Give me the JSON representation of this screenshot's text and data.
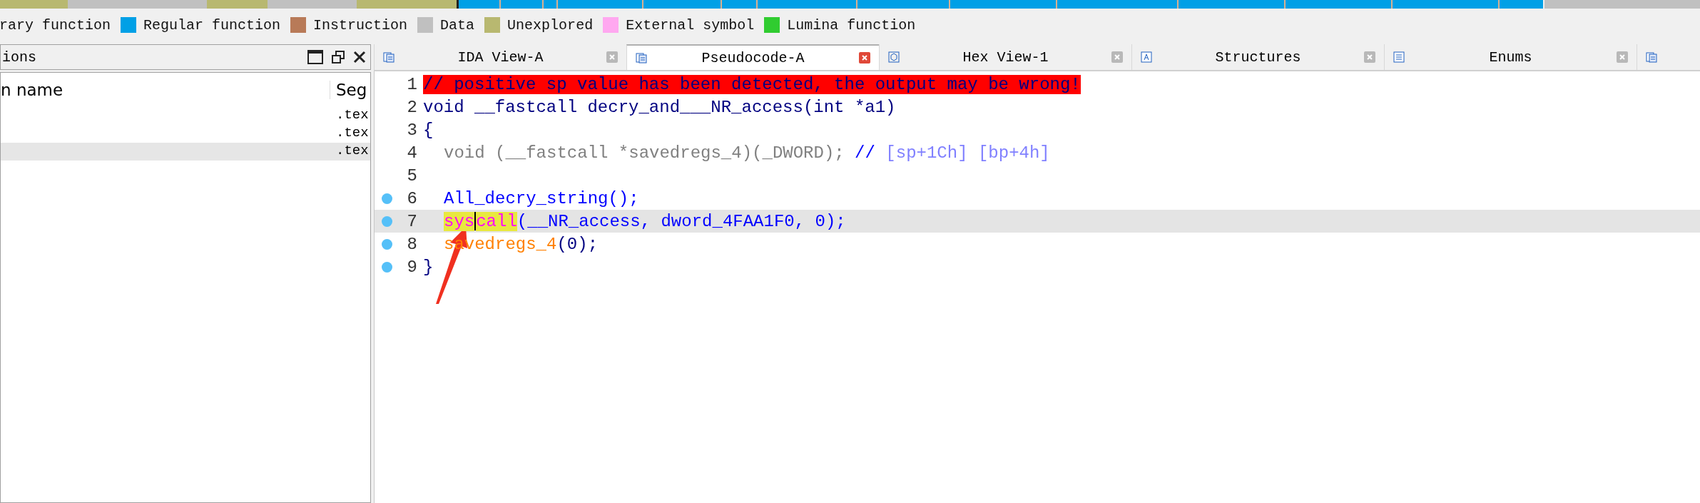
{
  "legend": [
    {
      "label": "rary function"
    },
    {
      "label": "Regular function",
      "color": "#00a0e6"
    },
    {
      "label": "Instruction",
      "color": "#b87a58"
    },
    {
      "label": "Data",
      "color": "#c0c0c0"
    },
    {
      "label": "Unexplored",
      "color": "#b8b870"
    },
    {
      "label": "External symbol",
      "color": "#ffa8f0"
    },
    {
      "label": "Lumina function",
      "color": "#30cc30"
    }
  ],
  "functions_panel": {
    "title": "ions",
    "columns": [
      "n name",
      "Seg"
    ],
    "rows": [
      {
        "segment": ".tex",
        "selected": false
      },
      {
        "segment": ".tex",
        "selected": false
      },
      {
        "segment": ".tex",
        "selected": true
      }
    ]
  },
  "tabs": [
    {
      "label": "IDA View-A",
      "selected": false,
      "kind": "view"
    },
    {
      "label": "Pseudocode-A",
      "selected": true,
      "kind": "view"
    },
    {
      "label": "Hex View-1",
      "selected": false,
      "kind": "hex"
    },
    {
      "label": "Structures",
      "selected": false,
      "kind": "struct"
    },
    {
      "label": "Enums",
      "selected": false,
      "kind": "enum"
    },
    {
      "selected": false,
      "kind": "view"
    }
  ],
  "code_lines": [
    {
      "number": "1",
      "breakpoint": false,
      "highlighted": false,
      "indent": false,
      "tokens": [
        {
          "text": "// positive sp value has been detected, the output may be wrong!",
          "kind": "warning"
        }
      ]
    },
    {
      "number": "2",
      "breakpoint": false,
      "highlighted": false,
      "indent": false,
      "tokens": [
        {
          "text": "void __fastcall decry_and___NR_access(int *a1)",
          "kind": "text"
        }
      ]
    },
    {
      "number": "3",
      "breakpoint": false,
      "highlighted": false,
      "indent": false,
      "tokens": [
        {
          "text": "{",
          "kind": "text"
        }
      ]
    },
    {
      "number": "4",
      "breakpoint": false,
      "highlighted": false,
      "indent": true,
      "tokens": [
        {
          "text": "void (__fastcall *savedregs_4)(_DWORD);",
          "kind": "dimmed"
        },
        {
          "text": " //",
          "kind": "comment"
        },
        {
          "text": " [sp+1Ch] [bp+4h]",
          "kind": "comment-ref"
        }
      ]
    },
    {
      "number": "5",
      "breakpoint": false,
      "highlighted": false
    },
    {
      "number": "6",
      "breakpoint": true,
      "highlighted": false,
      "indent": true,
      "tokens": [
        {
          "text": "All_decry_string();",
          "kind": "function"
        }
      ]
    },
    {
      "number": "7",
      "breakpoint": true,
      "highlighted": true,
      "indent": true,
      "tokens": [
        {
          "text": "sys",
          "kind": "marked"
        },
        {
          "text": "call",
          "kind": "marked",
          "cursor": true
        },
        {
          "text": "(__NR_access, dword_4FAA1F0, 0);",
          "kind": "function"
        }
      ]
    },
    {
      "number": "8",
      "breakpoint": true,
      "highlighted": false,
      "indent": true,
      "tokens": [
        {
          "text": "savedregs_4",
          "kind": "variable"
        },
        {
          "text": "(0);",
          "kind": "text"
        }
      ]
    },
    {
      "number": "9",
      "breakpoint": true,
      "highlighted": false,
      "indent": false,
      "tokens": [
        {
          "text": "}",
          "kind": "text"
        }
      ]
    }
  ]
}
